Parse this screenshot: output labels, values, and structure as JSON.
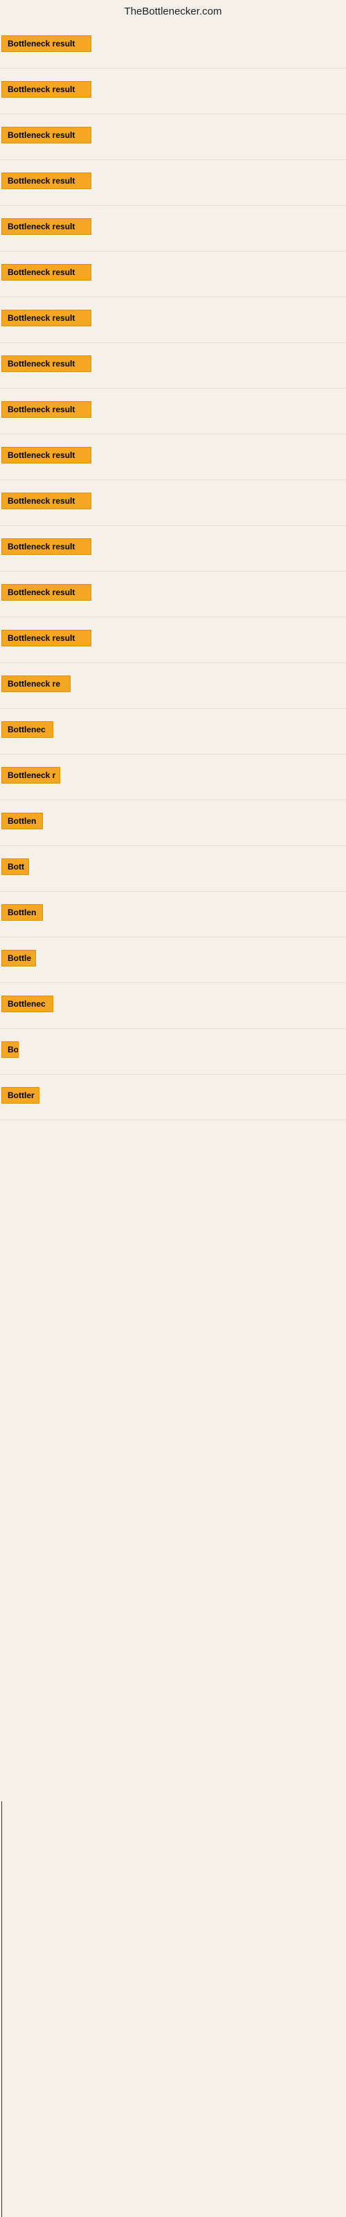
{
  "site": {
    "title": "TheBottlenecker.com"
  },
  "rows": [
    {
      "label": "Bottleneck result",
      "width": 130
    },
    {
      "label": "Bottleneck result",
      "width": 130
    },
    {
      "label": "Bottleneck result",
      "width": 130
    },
    {
      "label": "Bottleneck result",
      "width": 130
    },
    {
      "label": "Bottleneck result",
      "width": 130
    },
    {
      "label": "Bottleneck result",
      "width": 130
    },
    {
      "label": "Bottleneck result",
      "width": 130
    },
    {
      "label": "Bottleneck result",
      "width": 130
    },
    {
      "label": "Bottleneck result",
      "width": 130
    },
    {
      "label": "Bottleneck result",
      "width": 130
    },
    {
      "label": "Bottleneck result",
      "width": 130
    },
    {
      "label": "Bottleneck result",
      "width": 130
    },
    {
      "label": "Bottleneck result",
      "width": 130
    },
    {
      "label": "Bottleneck result",
      "width": 130
    },
    {
      "label": "Bottleneck re",
      "width": 100
    },
    {
      "label": "Bottlenec",
      "width": 75
    },
    {
      "label": "Bottleneck r",
      "width": 85
    },
    {
      "label": "Bottlen",
      "width": 60
    },
    {
      "label": "Bott",
      "width": 40
    },
    {
      "label": "Bottlen",
      "width": 60
    },
    {
      "label": "Bottle",
      "width": 50
    },
    {
      "label": "Bottlenec",
      "width": 75
    },
    {
      "label": "Bo",
      "width": 25
    },
    {
      "label": "Bottler",
      "width": 55
    }
  ]
}
